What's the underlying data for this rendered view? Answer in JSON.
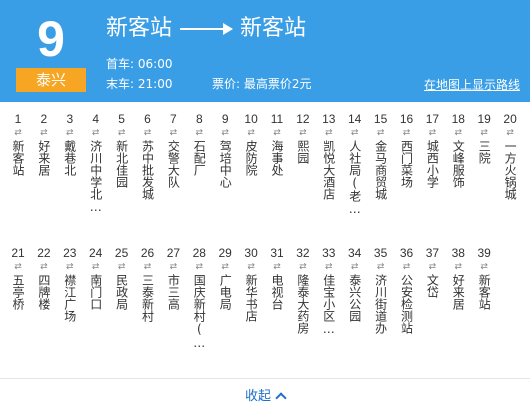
{
  "route": {
    "number": "9",
    "operator_tag": "泰兴",
    "from": "新客站",
    "to": "新客站",
    "first_bus_label": "首车:",
    "first_bus": "06:00",
    "last_bus_label": "末车:",
    "last_bus": "21:00",
    "fare_label": "票价:",
    "fare": "最高票价2元",
    "map_link": "在地图上显示路线"
  },
  "stops_row1": [
    {
      "num": "1",
      "name": "新客站"
    },
    {
      "num": "2",
      "name": "好来居"
    },
    {
      "num": "3",
      "name": "戴巷北"
    },
    {
      "num": "4",
      "name": "济川中学北…"
    },
    {
      "num": "5",
      "name": "新北佳园"
    },
    {
      "num": "6",
      "name": "苏中批发城"
    },
    {
      "num": "7",
      "name": "交警大队"
    },
    {
      "num": "8",
      "name": "石配厂"
    },
    {
      "num": "9",
      "name": "驾培中心"
    },
    {
      "num": "10",
      "name": "皮防院"
    },
    {
      "num": "11",
      "name": "海事处"
    },
    {
      "num": "12",
      "name": "熙园"
    },
    {
      "num": "13",
      "name": "凯悦大酒店"
    },
    {
      "num": "14",
      "name": "人社局(老…"
    },
    {
      "num": "15",
      "name": "金马商贸城"
    },
    {
      "num": "16",
      "name": "西门菜场"
    },
    {
      "num": "17",
      "name": "城西小学"
    },
    {
      "num": "18",
      "name": "文峰服饰"
    },
    {
      "num": "19",
      "name": "三院"
    },
    {
      "num": "20",
      "name": "一方火锅城"
    }
  ],
  "stops_row2": [
    {
      "num": "21",
      "name": "五亭桥"
    },
    {
      "num": "22",
      "name": "四牌楼"
    },
    {
      "num": "23",
      "name": "襟江广场"
    },
    {
      "num": "24",
      "name": "南门口"
    },
    {
      "num": "25",
      "name": "民政局"
    },
    {
      "num": "26",
      "name": "三泰新村"
    },
    {
      "num": "27",
      "name": "市三高"
    },
    {
      "num": "28",
      "name": "国庆新村(…"
    },
    {
      "num": "29",
      "name": "广电局"
    },
    {
      "num": "30",
      "name": "新华书店"
    },
    {
      "num": "31",
      "name": "电视台"
    },
    {
      "num": "32",
      "name": "隆泰大药房"
    },
    {
      "num": "33",
      "name": "佳宝小区…"
    },
    {
      "num": "34",
      "name": "泰兴公园"
    },
    {
      "num": "35",
      "name": "济川街道办"
    },
    {
      "num": "36",
      "name": "公安检测站"
    },
    {
      "num": "37",
      "name": "文岱"
    },
    {
      "num": "38",
      "name": "好来居"
    },
    {
      "num": "39",
      "name": "新客站"
    }
  ],
  "stop_arrows": "⇄",
  "collapse_label": "收起",
  "colors": {
    "header": "#3a9ee6",
    "tag": "#f6a623",
    "link": "#1f6fc8"
  }
}
